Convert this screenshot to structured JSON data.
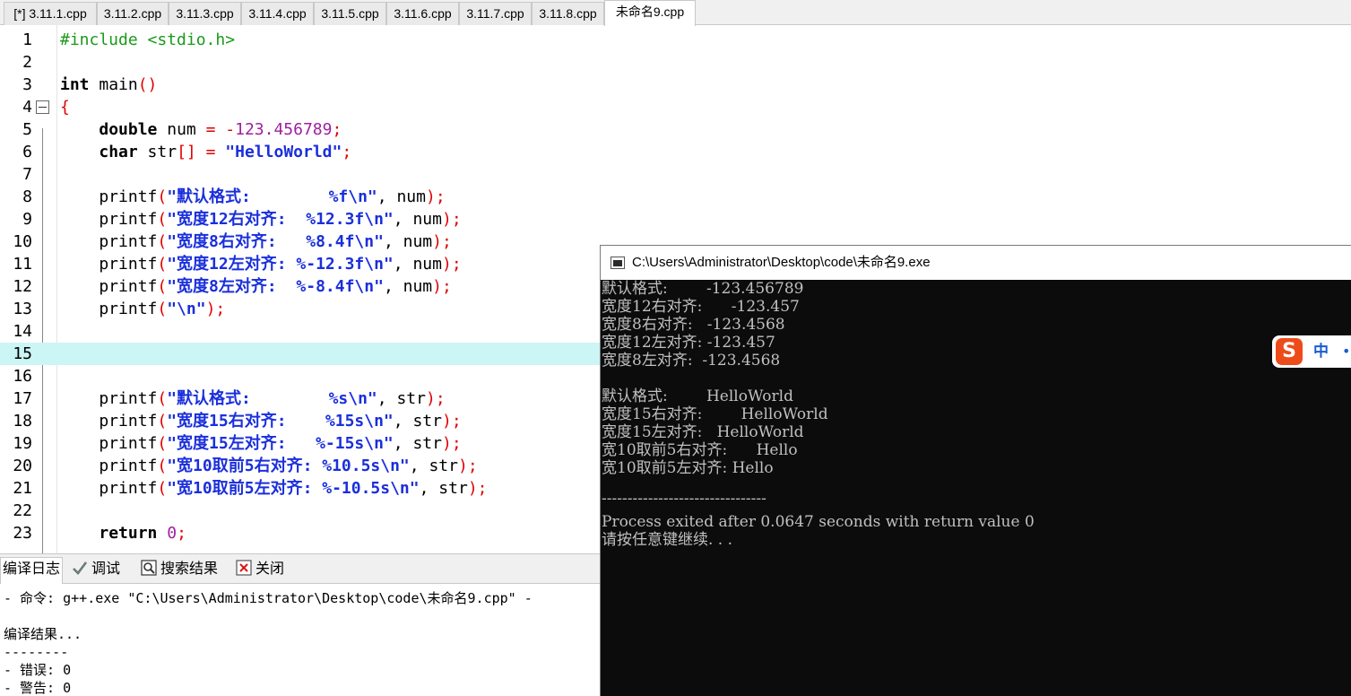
{
  "tabs": [
    {
      "label": "[*] 3.11.1.cpp",
      "active": false
    },
    {
      "label": "3.11.2.cpp",
      "active": false
    },
    {
      "label": "3.11.3.cpp",
      "active": false
    },
    {
      "label": "3.11.4.cpp",
      "active": false
    },
    {
      "label": "3.11.5.cpp",
      "active": false
    },
    {
      "label": "3.11.6.cpp",
      "active": false
    },
    {
      "label": "3.11.7.cpp",
      "active": false
    },
    {
      "label": "3.11.8.cpp",
      "active": false
    },
    {
      "label": "未命名9.cpp",
      "active": true
    }
  ],
  "editor": {
    "current_line": 15,
    "line_numbers": [
      "1",
      "2",
      "3",
      "4",
      "5",
      "6",
      "7",
      "8",
      "9",
      "10",
      "11",
      "12",
      "13",
      "14",
      "15",
      "16",
      "17",
      "18",
      "19",
      "20",
      "21",
      "22",
      "23"
    ],
    "lines": [
      [
        {
          "t": "#include <stdio.h>",
          "c": "pp"
        }
      ],
      [],
      [
        {
          "t": "int",
          "c": "kw"
        },
        {
          "t": " main"
        },
        {
          "t": "()",
          "c": "punc"
        }
      ],
      [
        {
          "t": "{",
          "c": "punc"
        }
      ],
      [
        {
          "t": "    "
        },
        {
          "t": "double",
          "c": "kw"
        },
        {
          "t": " num "
        },
        {
          "t": "=",
          "c": "punc"
        },
        {
          "t": " "
        },
        {
          "t": "-",
          "c": "punc"
        },
        {
          "t": "123.456789",
          "c": "num"
        },
        {
          "t": ";",
          "c": "punc"
        }
      ],
      [
        {
          "t": "    "
        },
        {
          "t": "char",
          "c": "kw"
        },
        {
          "t": " str"
        },
        {
          "t": "[]",
          "c": "punc"
        },
        {
          "t": " "
        },
        {
          "t": "=",
          "c": "punc"
        },
        {
          "t": " "
        },
        {
          "t": "\"HelloWorld\"",
          "c": "str"
        },
        {
          "t": ";",
          "c": "punc"
        }
      ],
      [],
      [
        {
          "t": "    printf"
        },
        {
          "t": "(",
          "c": "punc"
        },
        {
          "t": "\"默认格式:        %f\\n\"",
          "c": "str"
        },
        {
          "t": ","
        },
        {
          "t": " num"
        },
        {
          "t": ");",
          "c": "punc"
        }
      ],
      [
        {
          "t": "    printf"
        },
        {
          "t": "(",
          "c": "punc"
        },
        {
          "t": "\"宽度12右对齐:  %12.3f\\n\"",
          "c": "str"
        },
        {
          "t": ","
        },
        {
          "t": " num"
        },
        {
          "t": ");",
          "c": "punc"
        }
      ],
      [
        {
          "t": "    printf"
        },
        {
          "t": "(",
          "c": "punc"
        },
        {
          "t": "\"宽度8右对齐:   %8.4f\\n\"",
          "c": "str"
        },
        {
          "t": ","
        },
        {
          "t": " num"
        },
        {
          "t": ");",
          "c": "punc"
        }
      ],
      [
        {
          "t": "    printf"
        },
        {
          "t": "(",
          "c": "punc"
        },
        {
          "t": "\"宽度12左对齐: %-12.3f\\n\"",
          "c": "str"
        },
        {
          "t": ","
        },
        {
          "t": " num"
        },
        {
          "t": ");",
          "c": "punc"
        }
      ],
      [
        {
          "t": "    printf"
        },
        {
          "t": "(",
          "c": "punc"
        },
        {
          "t": "\"宽度8左对齐:  %-8.4f\\n\"",
          "c": "str"
        },
        {
          "t": ","
        },
        {
          "t": " num"
        },
        {
          "t": ");",
          "c": "punc"
        }
      ],
      [
        {
          "t": "    printf"
        },
        {
          "t": "(",
          "c": "punc"
        },
        {
          "t": "\"\\n\"",
          "c": "str"
        },
        {
          "t": ");",
          "c": "punc"
        }
      ],
      [],
      [],
      [],
      [
        {
          "t": "    printf"
        },
        {
          "t": "(",
          "c": "punc"
        },
        {
          "t": "\"默认格式:        %s\\n\"",
          "c": "str"
        },
        {
          "t": ","
        },
        {
          "t": " str"
        },
        {
          "t": ");",
          "c": "punc"
        }
      ],
      [
        {
          "t": "    printf"
        },
        {
          "t": "(",
          "c": "punc"
        },
        {
          "t": "\"宽度15右对齐:    %15s\\n\"",
          "c": "str"
        },
        {
          "t": ","
        },
        {
          "t": " str"
        },
        {
          "t": ");",
          "c": "punc"
        }
      ],
      [
        {
          "t": "    printf"
        },
        {
          "t": "(",
          "c": "punc"
        },
        {
          "t": "\"宽度15左对齐:   %-15s\\n\"",
          "c": "str"
        },
        {
          "t": ","
        },
        {
          "t": " str"
        },
        {
          "t": ");",
          "c": "punc"
        }
      ],
      [
        {
          "t": "    printf"
        },
        {
          "t": "(",
          "c": "punc"
        },
        {
          "t": "\"宽10取前5右对齐: %10.5s\\n\"",
          "c": "str"
        },
        {
          "t": ","
        },
        {
          "t": " str"
        },
        {
          "t": ");",
          "c": "punc"
        }
      ],
      [
        {
          "t": "    printf"
        },
        {
          "t": "(",
          "c": "punc"
        },
        {
          "t": "\"宽10取前5左对齐: %-10.5s\\n\"",
          "c": "str"
        },
        {
          "t": ","
        },
        {
          "t": " str"
        },
        {
          "t": ");",
          "c": "punc"
        }
      ],
      [],
      [
        {
          "t": "    "
        },
        {
          "t": "return",
          "c": "kw"
        },
        {
          "t": " "
        },
        {
          "t": "0",
          "c": "num"
        },
        {
          "t": ";",
          "c": "punc"
        }
      ]
    ]
  },
  "bottom_panel": {
    "tabs": {
      "compile_log": "编译日志",
      "debug": "调试",
      "search_results": "搜索结果",
      "close": "关闭"
    },
    "log_lines": [
      "- 命令: g++.exe \"C:\\Users\\Administrator\\Desktop\\code\\未命名9.cpp\" -",
      "",
      "编译结果...",
      "--------",
      "- 错误: 0",
      "- 警告: 0"
    ]
  },
  "console": {
    "title": "C:\\Users\\Administrator\\Desktop\\code\\未命名9.exe",
    "lines": [
      "默认格式:        -123.456789",
      "宽度12右对齐:      -123.457",
      "宽度8右对齐:   -123.4568",
      "宽度12左对齐: -123.457",
      "宽度8左对齐:  -123.4568",
      "",
      "默认格式:        HelloWorld",
      "宽度15右对齐:        HelloWorld",
      "宽度15左对齐:   HelloWorld",
      "宽10取前5右对齐:      Hello",
      "宽10取前5左对齐: Hello",
      "",
      "--------------------------------",
      "Process exited after 0.0647 seconds with return value 0",
      "请按任意键继续. . ."
    ]
  },
  "ime": {
    "mode_label": "中",
    "extra": "•",
    "logo_letter": "S"
  },
  "colors": {
    "string": "#1a2fdc",
    "keyword": "#000000",
    "preprocessor": "#1a9a1a",
    "number": "#a020a0",
    "punctuation": "#e00000",
    "current_line": "#ccf5f5",
    "console_bg": "#0c0c0c",
    "console_fg": "#c0c0c0",
    "ime_brand": "#ee4b1a"
  }
}
